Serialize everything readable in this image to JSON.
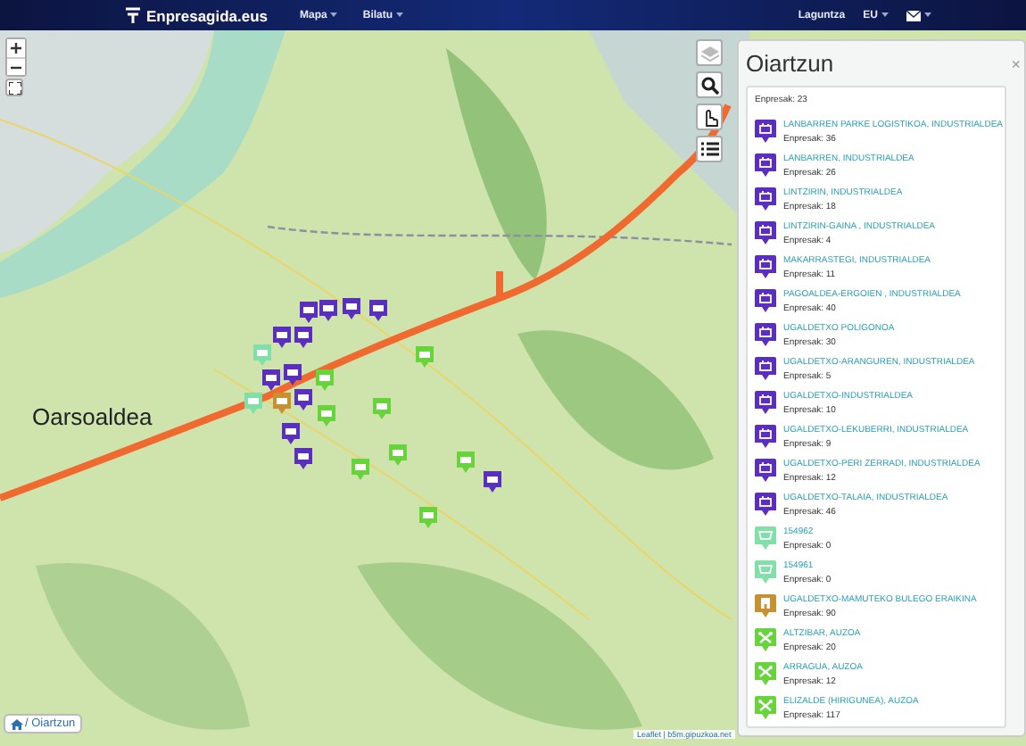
{
  "navbar": {
    "logo": "Enpresagida.eus",
    "menus": [
      {
        "label": "Mapa",
        "kind": "dropdown"
      },
      {
        "label": "Bilatu",
        "kind": "dropdown"
      }
    ],
    "right": [
      {
        "label": "Laguntza",
        "kind": "link"
      },
      {
        "label": "EU",
        "kind": "dropdown"
      },
      {
        "kind": "mail"
      }
    ]
  },
  "map": {
    "place_label": "Oarsoaldea",
    "breadcrumb": "/ Oiartzun",
    "attribution": "Leaflet | b5m.gipuzkoa.net"
  },
  "panel": {
    "title": "Oiartzun",
    "close": "×",
    "total": "Enpresak: 23",
    "items": [
      {
        "kind": "industrial",
        "name": "LANBARREN PARKE LOGISTIKOA, INDUSTRIALDEA",
        "count": "Enpresak: 36"
      },
      {
        "kind": "industrial",
        "name": "LANBARREN, INDUSTRIALDEA",
        "count": "Enpresak: 26"
      },
      {
        "kind": "industrial",
        "name": "LINTZIRIN, INDUSTRIALDEA",
        "count": "Enpresak: 18"
      },
      {
        "kind": "industrial",
        "name": "LINTZIRIN-GAINA , INDUSTRIALDEA",
        "count": "Enpresak: 4"
      },
      {
        "kind": "industrial",
        "name": "MAKARRASTEGI, INDUSTRIALDEA",
        "count": "Enpresak: 11"
      },
      {
        "kind": "industrial",
        "name": "PAGOALDEA-ERGOIEN , INDUSTRIALDEA",
        "count": "Enpresak: 40"
      },
      {
        "kind": "industrial",
        "name": "UGALDETXO POLIGONOA",
        "count": "Enpresak: 30"
      },
      {
        "kind": "industrial",
        "name": "UGALDETXO-ARANGUREN, INDUSTRIALDEA",
        "count": "Enpresak: 5"
      },
      {
        "kind": "industrial",
        "name": "UGALDETXO-INDUSTRIALDEA",
        "count": "Enpresak: 10"
      },
      {
        "kind": "industrial",
        "name": "UGALDETXO-LEKUBERRI, INDUSTRIALDEA",
        "count": "Enpresak: 9"
      },
      {
        "kind": "industrial",
        "name": "UGALDETXO-PERI ZERRADI, INDUSTRIALDEA",
        "count": "Enpresak: 12"
      },
      {
        "kind": "industrial",
        "name": "UGALDETXO-TALAIA, INDUSTRIALDEA",
        "count": "Enpresak: 46"
      },
      {
        "kind": "commercial",
        "name": "154962",
        "count": "Enpresak: 0"
      },
      {
        "kind": "commercial",
        "name": "154961",
        "count": "Enpresak: 0"
      },
      {
        "kind": "office",
        "name": "UGALDETXO-MAMUTEKO BULEGO ERAIKINA",
        "count": "Enpresak: 90"
      },
      {
        "kind": "neighborhood",
        "name": "ALTZIBAR, AUZOA",
        "count": "Enpresak: 20"
      },
      {
        "kind": "neighborhood",
        "name": "ARRAGUA, AUZOA",
        "count": "Enpresak: 12"
      },
      {
        "kind": "neighborhood",
        "name": "ELIZALDE (HIRIGUNEA), AUZOA",
        "count": "Enpresak: 117"
      }
    ]
  }
}
